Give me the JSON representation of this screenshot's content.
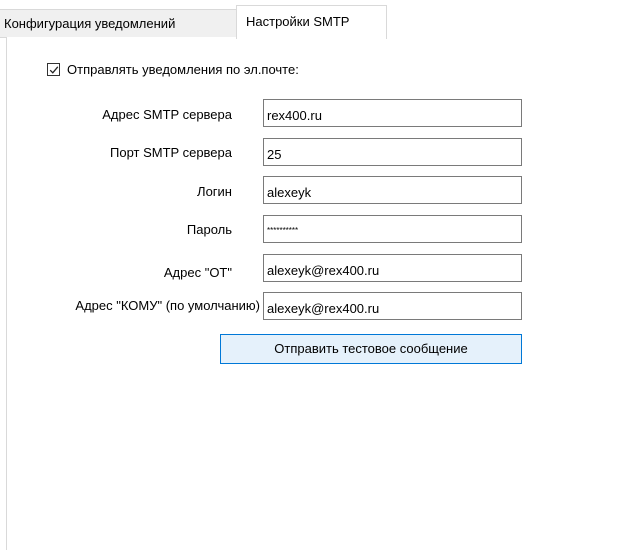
{
  "tabs": [
    {
      "label": "Конфигурация уведомлений",
      "active": false
    },
    {
      "label": "Настройки SMTP",
      "active": true
    }
  ],
  "email_notifications": {
    "label": "Отправлять уведомления по эл.почте:",
    "checked": true
  },
  "form": {
    "smtp_server": {
      "label": "Адрес SMTP сервера",
      "value": "rex400.ru"
    },
    "smtp_port": {
      "label": "Порт SMTP сервера",
      "value": "25"
    },
    "login": {
      "label": "Логин",
      "value": "alexeyk"
    },
    "password": {
      "label": "Пароль",
      "value": "**********"
    },
    "from_address": {
      "label": "Адрес \"ОТ\"",
      "value": "alexeyk@rex400.ru"
    },
    "to_address": {
      "label": "Адрес \"КОМУ\" (по умолчанию)",
      "value": "alexeyk@rex400.ru"
    }
  },
  "test_button": {
    "label": "Отправить тестовое сообщение"
  },
  "colors": {
    "button_border": "#0078d7",
    "button_background": "#e5f1fb",
    "tab_inactive_background": "#f0f0f0",
    "border": "#d9d9d9"
  }
}
